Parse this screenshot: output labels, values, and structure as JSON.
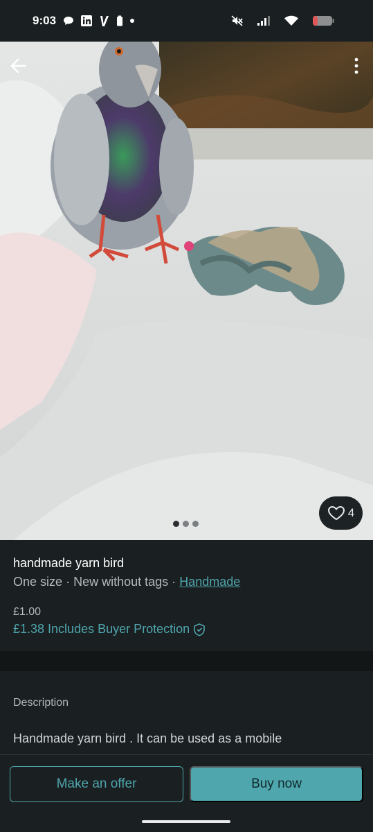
{
  "status_bar": {
    "time": "9:03",
    "left_icons": [
      "chat-bubble-icon",
      "linkedin-icon",
      "v-app-icon",
      "battery-saver-icon",
      "notification-dot-icon"
    ],
    "right_icons": [
      "mute-icon",
      "signal-icon",
      "wifi-icon",
      "battery-icon"
    ]
  },
  "gallery": {
    "page_count": 3,
    "current_page": 1,
    "favourites_count": "4"
  },
  "item": {
    "title": "handmade yarn bird",
    "size": "One size",
    "separator": "·",
    "condition": "New without tags",
    "brand": "Handmade",
    "price": "£1.00",
    "total_price": "£1.38",
    "protection_label": "Includes Buyer Protection"
  },
  "description": {
    "label": "Description",
    "text": "Handmade yarn bird . It can be used as a mobile"
  },
  "actions": {
    "offer_label": "Make an offer",
    "buy_label": "Buy now"
  },
  "colors": {
    "background": "#1a1f21",
    "accent": "#4fa6ad",
    "divider": "#121617"
  }
}
